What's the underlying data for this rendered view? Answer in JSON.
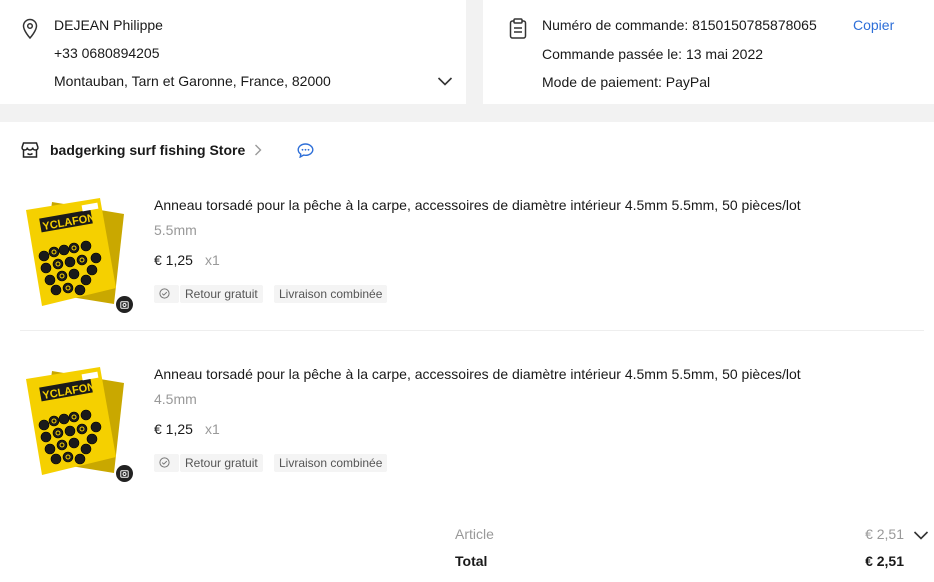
{
  "address": {
    "name": "DEJEAN Philippe",
    "phone": "+33 0680894205",
    "location": "Montauban, Tarn et Garonne, France, 82000"
  },
  "order": {
    "number_text": "Numéro de commande: 8150150785878065",
    "copy_label": "Copier",
    "date_text": "Commande passée le: 13 mai 2022",
    "payment_text": "Mode de paiement: PayPal"
  },
  "store": {
    "name": "badgerking surf fishing Store"
  },
  "items": [
    {
      "title": "Anneau torsadé pour la pêche à la carpe, accessoires de diamètre intérieur 4.5mm 5.5mm, 50 pièces/lot",
      "variant": "5.5mm",
      "price": "€ 1,25",
      "qty": "x1",
      "tag1": "Retour gratuit",
      "tag2": "Livraison combinée",
      "image_brand": "YCLAFON"
    },
    {
      "title": "Anneau torsadé pour la pêche à la carpe, accessoires de diamètre intérieur 4.5mm 5.5mm, 50 pièces/lot",
      "variant": "4.5mm",
      "price": "€ 1,25",
      "qty": "x1",
      "tag1": "Retour gratuit",
      "tag2": "Livraison combinée",
      "image_brand": "YCLAFON"
    }
  ],
  "summary": {
    "article_label": "Article",
    "article_value": "€ 2,51",
    "total_label": "Total",
    "total_value": "€ 2,51"
  },
  "colors": {
    "link": "#2e6fd8",
    "muted": "#999999",
    "package_yellow": "#f5d000"
  }
}
